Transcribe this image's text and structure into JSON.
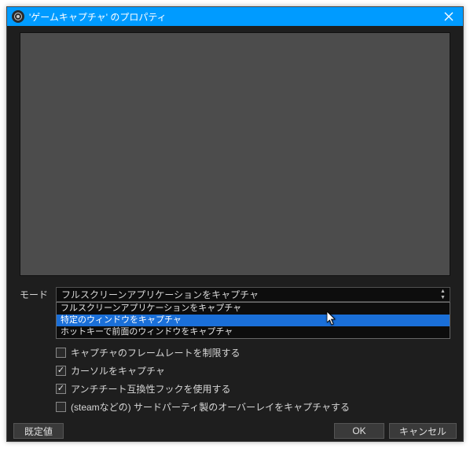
{
  "titlebar": {
    "title": "'ゲームキャプチャ' のプロパティ"
  },
  "form": {
    "mode_label": "モード",
    "mode_value": "フルスクリーンアプリケーションをキャプチャ",
    "mode_options": [
      "フルスクリーンアプリケーションをキャプチャ",
      "特定のウィンドウをキャプチャ",
      "ホットキーで前面のウィンドウをキャプチャ"
    ]
  },
  "checks": [
    {
      "label": "キャプチャのフレームレートを制限する",
      "checked": false
    },
    {
      "label": "カーソルをキャプチャ",
      "checked": true
    },
    {
      "label": "アンチチート互換性フックを使用する",
      "checked": true
    },
    {
      "label": "(steamなどの) サードパーティ製のオーバーレイをキャプチャする",
      "checked": false
    }
  ],
  "footer": {
    "defaults": "既定値",
    "ok": "OK",
    "cancel": "キャンセル"
  }
}
